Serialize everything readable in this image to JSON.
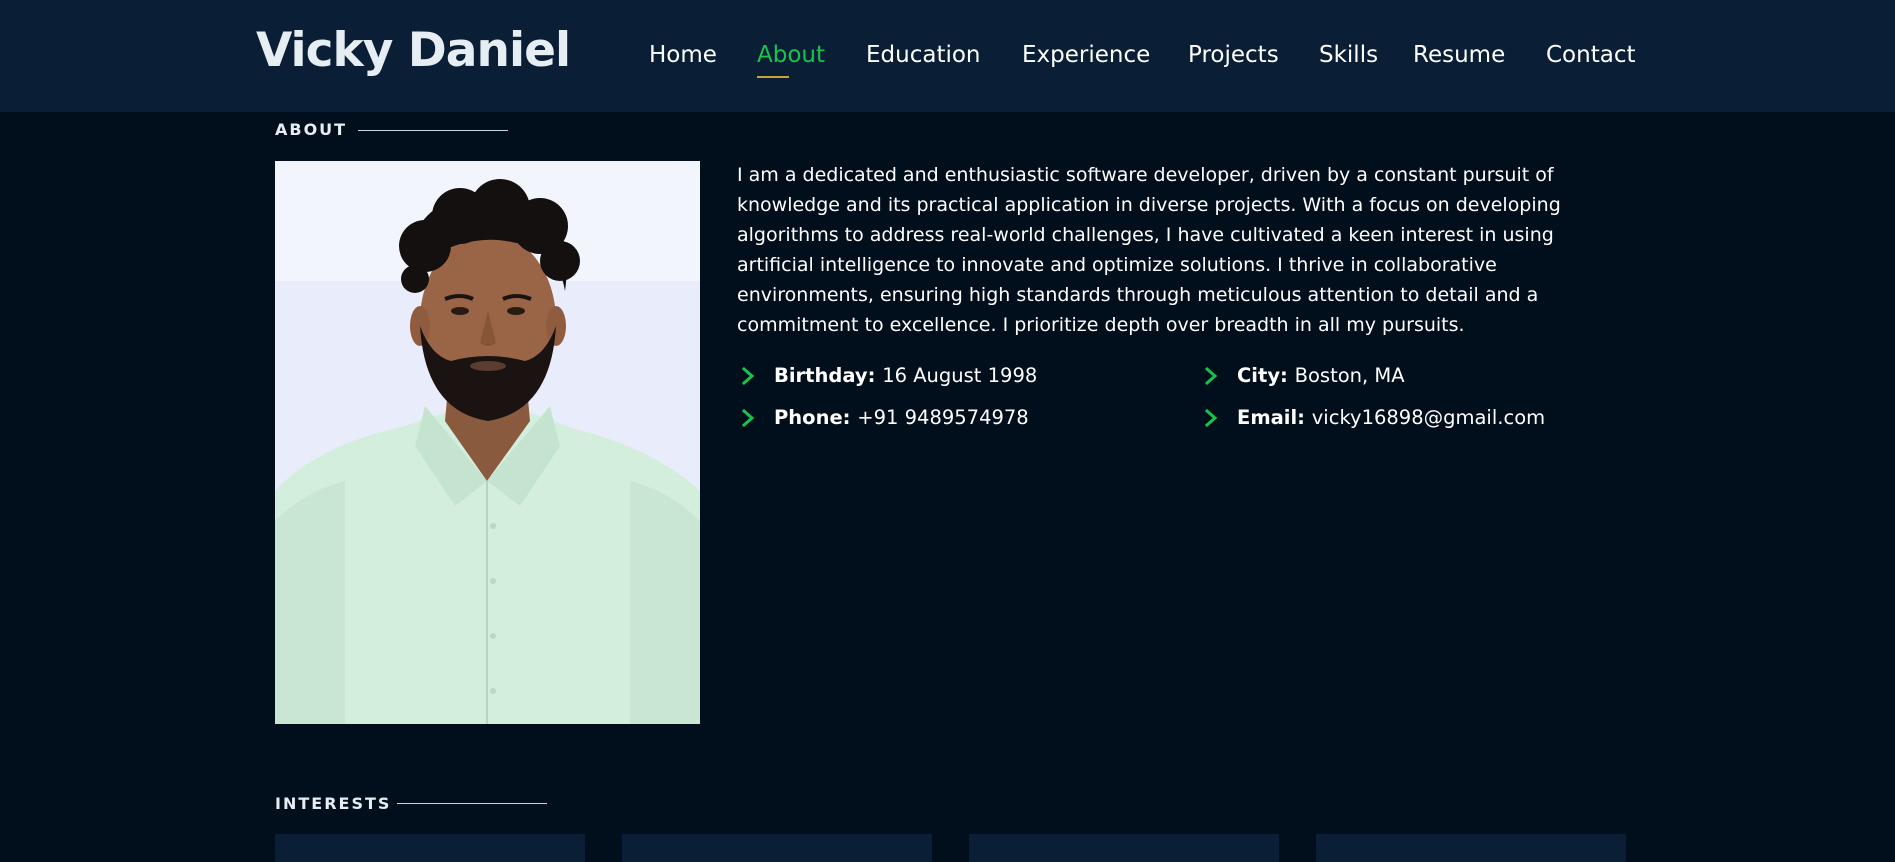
{
  "header": {
    "logo": "Vicky Daniel",
    "nav": [
      {
        "label": "Home",
        "active": false
      },
      {
        "label": "About",
        "active": true
      },
      {
        "label": "Education",
        "active": false
      },
      {
        "label": "Experience",
        "active": false
      },
      {
        "label": "Projects",
        "active": false
      },
      {
        "label": "Skills",
        "active": false
      },
      {
        "label": "Resume",
        "active": false
      },
      {
        "label": "Contact",
        "active": false
      }
    ]
  },
  "about": {
    "section_title": "ABOUT",
    "bio": "I am a dedicated and enthusiastic software developer, driven by a constant pursuit of knowledge and its practical application in diverse projects. With a focus on developing algorithms to address real-world challenges, I have cultivated a keen interest in using artificial intelligence to innovate and optimize solutions. I thrive in collaborative environments, ensuring high standards through meticulous attention to detail and a commitment to excellence. I prioritize depth over breadth in all my pursuits.",
    "info": {
      "birthday": {
        "label": "Birthday:",
        "value": "16 August 1998"
      },
      "city": {
        "label": "City:",
        "value": "Boston, MA"
      },
      "phone": {
        "label": "Phone:",
        "value": "+91 9489574978"
      },
      "email": {
        "label": "Email:",
        "value": "vicky16898@gmail.com"
      }
    }
  },
  "interests": {
    "section_title": "INTERESTS"
  },
  "colors": {
    "header_bg": "#0a1e36",
    "page_bg": "#010e1b",
    "accent_green": "#19c34b",
    "nav_underline": "#c7a13a"
  }
}
